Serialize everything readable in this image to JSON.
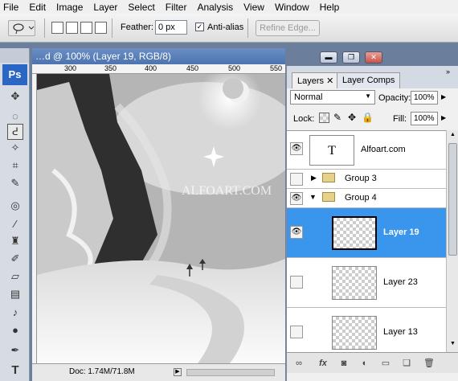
{
  "menu": [
    "File",
    "Edit",
    "Image",
    "Layer",
    "Select",
    "Filter",
    "Analysis",
    "View",
    "Window",
    "Help"
  ],
  "options": {
    "feather_label": "Feather:",
    "feather_value": "0 px",
    "antialias_label": "Anti-alias",
    "antialias_checked": true,
    "refine_edge_label": "Refine Edge..."
  },
  "toolbox": {
    "logo": "Ps",
    "tools": [
      "move-tool",
      "marquee-tool",
      "lasso-tool",
      "magic-wand-tool",
      "crop-tool",
      "eyedropper-tool",
      "healing-brush-tool",
      "brush-tool",
      "clone-stamp-tool",
      "history-brush-tool",
      "eraser-tool",
      "gradient-tool",
      "dodge-tool",
      "burn-tool",
      "pen-tool",
      "type-tool"
    ],
    "active_tool": "lasso-tool"
  },
  "document": {
    "title": "…d @ 100% (Layer 19, RGB/8)",
    "ruler_ticks": [
      "300",
      "350",
      "400",
      "450",
      "500",
      "550"
    ],
    "watermark": "ALFOART.COM",
    "status": "Doc: 1.74M/71.8M"
  },
  "layers_panel": {
    "tabs": [
      "Layers",
      "Layer Comps"
    ],
    "active_tab": "Layers",
    "blend_mode": "Normal",
    "opacity_label": "Opacity:",
    "opacity": "100%",
    "lock_label": "Lock:",
    "fill_label": "Fill:",
    "fill": "100%",
    "layers": [
      {
        "name": "Alfoart.com",
        "type": "text",
        "visible": true,
        "thumb_text": "T"
      },
      {
        "name": "Group 3",
        "type": "group",
        "visible": false,
        "expanded": false
      },
      {
        "name": "Group 4",
        "type": "group",
        "visible": true,
        "expanded": true
      },
      {
        "name": "Layer 19",
        "type": "layer",
        "visible": true,
        "selected": true
      },
      {
        "name": "Layer 23",
        "type": "layer",
        "visible": false
      },
      {
        "name": "Layer 13",
        "type": "layer",
        "visible": false
      }
    ]
  }
}
